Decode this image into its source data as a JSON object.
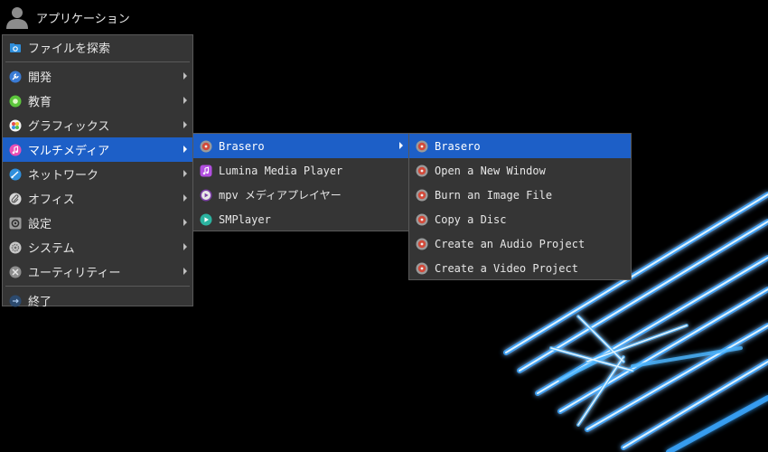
{
  "panel": {
    "app_button_label": "アプリケーション",
    "icon": "user-icon"
  },
  "main_menu": {
    "search_label": "ファイルを探索",
    "items": [
      {
        "label": "開発",
        "icon": "wrench-icon",
        "submenu": true
      },
      {
        "label": "教育",
        "icon": "education-icon",
        "submenu": true
      },
      {
        "label": "グラフィックス",
        "icon": "graphics-icon",
        "submenu": true
      },
      {
        "label": "マルチメディア",
        "icon": "music-note-icon",
        "submenu": true,
        "active": true
      },
      {
        "label": "ネットワーク",
        "icon": "network-icon",
        "submenu": true
      },
      {
        "label": "オフィス",
        "icon": "paperclip-icon",
        "submenu": true
      },
      {
        "label": "設定",
        "icon": "settings-icon",
        "submenu": true
      },
      {
        "label": "システム",
        "icon": "system-gear-icon",
        "submenu": true
      },
      {
        "label": "ユーティリティー",
        "icon": "tools-icon",
        "submenu": true
      }
    ],
    "quit_label": "終了"
  },
  "multimedia_menu": {
    "items": [
      {
        "label": "Brasero",
        "icon": "brasero-disc-icon",
        "submenu": true,
        "active": true
      },
      {
        "label": "Lumina Media Player",
        "icon": "media-player-icon"
      },
      {
        "label": "mpv メディアプレイヤー",
        "icon": "mpv-play-icon"
      },
      {
        "label": "SMPlayer",
        "icon": "smplayer-play-icon"
      }
    ]
  },
  "brasero_menu": {
    "items": [
      {
        "label": "Brasero",
        "active": true
      },
      {
        "label": "Open a New Window"
      },
      {
        "label": "Burn an Image File"
      },
      {
        "label": "Copy a Disc"
      },
      {
        "label": "Create an Audio Project"
      },
      {
        "label": "Create a Video Project"
      }
    ]
  },
  "colors": {
    "menu_bg": "#353535",
    "highlight": "#1d5fc7",
    "text": "#e6e6e6"
  }
}
